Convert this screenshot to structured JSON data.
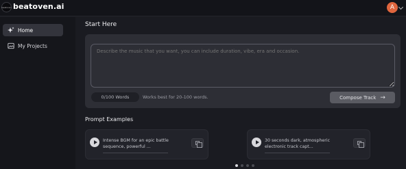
{
  "header": {
    "logo_text": "beatoven",
    "brand": "beatoven.ai",
    "avatar_initial": "A"
  },
  "sidebar": {
    "items": [
      {
        "label": "Home",
        "icon": "sparkle-icon",
        "active": true
      },
      {
        "label": "My Projects",
        "icon": "image-icon",
        "active": false
      }
    ]
  },
  "main": {
    "title": "Start Here",
    "prompt_placeholder": "Describe the music that you want, you can include duration, vibe, era and occasion.",
    "word_count": "0/100 Words",
    "hint": "Works best for 20-100 words.",
    "compose_label": "Compose Track"
  },
  "examples": {
    "title": "Prompt Examples",
    "items": [
      {
        "text": "Intense BGM for an epic battle sequence, powerful ..."
      },
      {
        "text": "30 seconds dark, atmospheric electronic track capt..."
      }
    ],
    "pagination": {
      "pages": 4,
      "current": 1
    }
  },
  "colors": {
    "background": "#1a1b21",
    "card": "#2d2e35",
    "avatar": "#e0663e",
    "button": "#5a5b62"
  }
}
